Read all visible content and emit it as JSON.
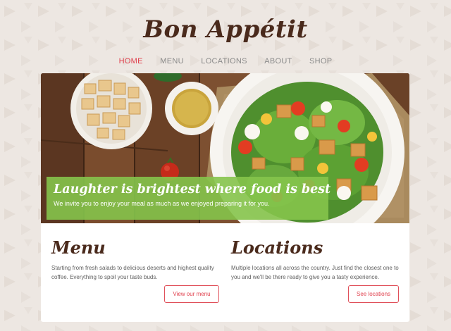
{
  "brand": {
    "name": "Bon Appétit"
  },
  "nav": {
    "items": [
      {
        "label": "HOME",
        "active": true
      },
      {
        "label": "MENU",
        "active": false
      },
      {
        "label": "LOCATIONS",
        "active": false
      },
      {
        "label": "ABOUT",
        "active": false
      },
      {
        "label": "SHOP",
        "active": false
      }
    ]
  },
  "hero": {
    "title": "Laughter is brightest where food is best",
    "subtitle": "We invite you to enjoy your meal as much as we enjoyed preparing it for you."
  },
  "cards": [
    {
      "title": "Menu",
      "text": "Starting from fresh salads to delicious deserts and highest quality coffee. Everything to spoil your taste buds.",
      "button": "View our menu"
    },
    {
      "title": "Locations",
      "text": "Multiple locations all across the country. Just find the closest one to you and we'll be there ready to give you a tasty experience.",
      "button": "See locations"
    }
  ],
  "colors": {
    "accent": "#e0404d",
    "brand_brown": "#4a2a1c",
    "caption_green": "#85c44b",
    "background": "#ede7e2"
  }
}
